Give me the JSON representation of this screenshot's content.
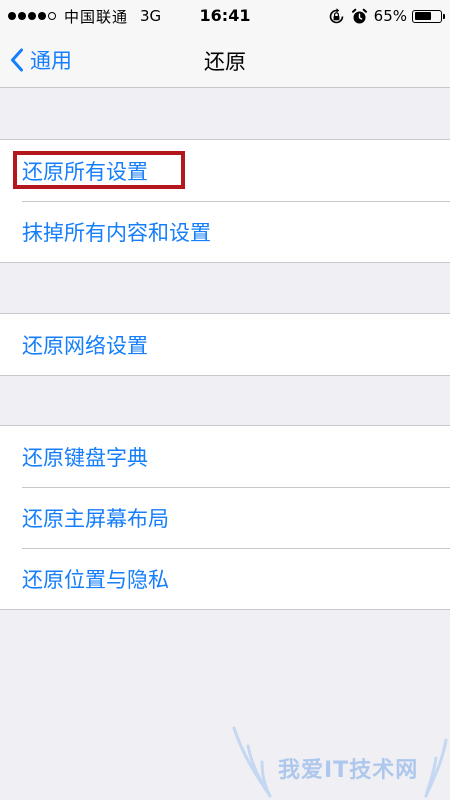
{
  "status_bar": {
    "signal_filled": 4,
    "signal_total": 5,
    "carrier": "中国联通",
    "network": "3G",
    "time": "16:41",
    "battery_percent": "65%",
    "battery_level": 0.65,
    "icons": [
      "rotation-lock-icon",
      "alarm-icon"
    ]
  },
  "nav": {
    "back_label": "通用",
    "title": "还原"
  },
  "groups": [
    {
      "items": [
        {
          "label": "还原所有设置",
          "highlighted": true
        },
        {
          "label": "抹掉所有内容和设置"
        }
      ]
    },
    {
      "items": [
        {
          "label": "还原网络设置"
        }
      ]
    },
    {
      "items": [
        {
          "label": "还原键盘字典"
        },
        {
          "label": "还原主屏幕布局"
        },
        {
          "label": "还原位置与隐私"
        }
      ]
    }
  ],
  "watermark": {
    "text": "我爱IT技术网"
  },
  "colors": {
    "accent": "#157efb",
    "background": "#efeff4",
    "separator": "#c8c7cc",
    "highlight": "#b3161c"
  }
}
